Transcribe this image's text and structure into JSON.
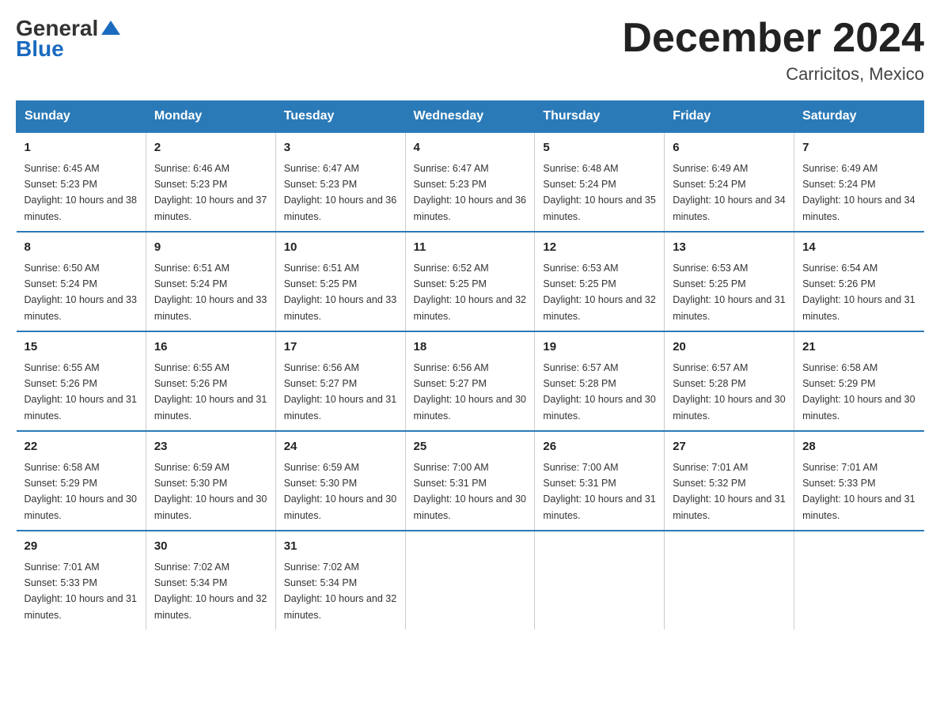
{
  "header": {
    "logo_general": "General",
    "logo_blue": "Blue",
    "title": "December 2024",
    "subtitle": "Carricitos, Mexico"
  },
  "weekdays": [
    "Sunday",
    "Monday",
    "Tuesday",
    "Wednesday",
    "Thursday",
    "Friday",
    "Saturday"
  ],
  "weeks": [
    [
      {
        "day": "1",
        "sunrise": "6:45 AM",
        "sunset": "5:23 PM",
        "daylight": "10 hours and 38 minutes."
      },
      {
        "day": "2",
        "sunrise": "6:46 AM",
        "sunset": "5:23 PM",
        "daylight": "10 hours and 37 minutes."
      },
      {
        "day": "3",
        "sunrise": "6:47 AM",
        "sunset": "5:23 PM",
        "daylight": "10 hours and 36 minutes."
      },
      {
        "day": "4",
        "sunrise": "6:47 AM",
        "sunset": "5:23 PM",
        "daylight": "10 hours and 36 minutes."
      },
      {
        "day": "5",
        "sunrise": "6:48 AM",
        "sunset": "5:24 PM",
        "daylight": "10 hours and 35 minutes."
      },
      {
        "day": "6",
        "sunrise": "6:49 AM",
        "sunset": "5:24 PM",
        "daylight": "10 hours and 34 minutes."
      },
      {
        "day": "7",
        "sunrise": "6:49 AM",
        "sunset": "5:24 PM",
        "daylight": "10 hours and 34 minutes."
      }
    ],
    [
      {
        "day": "8",
        "sunrise": "6:50 AM",
        "sunset": "5:24 PM",
        "daylight": "10 hours and 33 minutes."
      },
      {
        "day": "9",
        "sunrise": "6:51 AM",
        "sunset": "5:24 PM",
        "daylight": "10 hours and 33 minutes."
      },
      {
        "day": "10",
        "sunrise": "6:51 AM",
        "sunset": "5:25 PM",
        "daylight": "10 hours and 33 minutes."
      },
      {
        "day": "11",
        "sunrise": "6:52 AM",
        "sunset": "5:25 PM",
        "daylight": "10 hours and 32 minutes."
      },
      {
        "day": "12",
        "sunrise": "6:53 AM",
        "sunset": "5:25 PM",
        "daylight": "10 hours and 32 minutes."
      },
      {
        "day": "13",
        "sunrise": "6:53 AM",
        "sunset": "5:25 PM",
        "daylight": "10 hours and 31 minutes."
      },
      {
        "day": "14",
        "sunrise": "6:54 AM",
        "sunset": "5:26 PM",
        "daylight": "10 hours and 31 minutes."
      }
    ],
    [
      {
        "day": "15",
        "sunrise": "6:55 AM",
        "sunset": "5:26 PM",
        "daylight": "10 hours and 31 minutes."
      },
      {
        "day": "16",
        "sunrise": "6:55 AM",
        "sunset": "5:26 PM",
        "daylight": "10 hours and 31 minutes."
      },
      {
        "day": "17",
        "sunrise": "6:56 AM",
        "sunset": "5:27 PM",
        "daylight": "10 hours and 31 minutes."
      },
      {
        "day": "18",
        "sunrise": "6:56 AM",
        "sunset": "5:27 PM",
        "daylight": "10 hours and 30 minutes."
      },
      {
        "day": "19",
        "sunrise": "6:57 AM",
        "sunset": "5:28 PM",
        "daylight": "10 hours and 30 minutes."
      },
      {
        "day": "20",
        "sunrise": "6:57 AM",
        "sunset": "5:28 PM",
        "daylight": "10 hours and 30 minutes."
      },
      {
        "day": "21",
        "sunrise": "6:58 AM",
        "sunset": "5:29 PM",
        "daylight": "10 hours and 30 minutes."
      }
    ],
    [
      {
        "day": "22",
        "sunrise": "6:58 AM",
        "sunset": "5:29 PM",
        "daylight": "10 hours and 30 minutes."
      },
      {
        "day": "23",
        "sunrise": "6:59 AM",
        "sunset": "5:30 PM",
        "daylight": "10 hours and 30 minutes."
      },
      {
        "day": "24",
        "sunrise": "6:59 AM",
        "sunset": "5:30 PM",
        "daylight": "10 hours and 30 minutes."
      },
      {
        "day": "25",
        "sunrise": "7:00 AM",
        "sunset": "5:31 PM",
        "daylight": "10 hours and 30 minutes."
      },
      {
        "day": "26",
        "sunrise": "7:00 AM",
        "sunset": "5:31 PM",
        "daylight": "10 hours and 31 minutes."
      },
      {
        "day": "27",
        "sunrise": "7:01 AM",
        "sunset": "5:32 PM",
        "daylight": "10 hours and 31 minutes."
      },
      {
        "day": "28",
        "sunrise": "7:01 AM",
        "sunset": "5:33 PM",
        "daylight": "10 hours and 31 minutes."
      }
    ],
    [
      {
        "day": "29",
        "sunrise": "7:01 AM",
        "sunset": "5:33 PM",
        "daylight": "10 hours and 31 minutes."
      },
      {
        "day": "30",
        "sunrise": "7:02 AM",
        "sunset": "5:34 PM",
        "daylight": "10 hours and 32 minutes."
      },
      {
        "day": "31",
        "sunrise": "7:02 AM",
        "sunset": "5:34 PM",
        "daylight": "10 hours and 32 minutes."
      },
      null,
      null,
      null,
      null
    ]
  ]
}
